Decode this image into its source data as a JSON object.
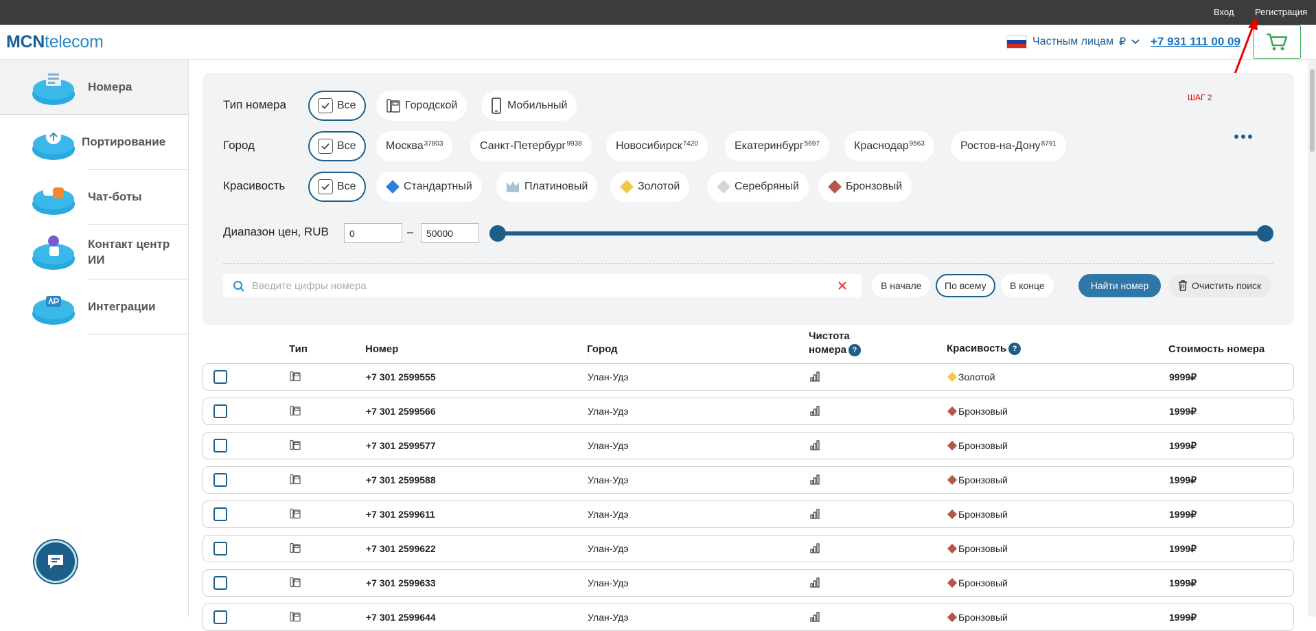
{
  "topbar": {
    "login": "Вход",
    "register": "Регистрация"
  },
  "header": {
    "logo_bold": "MCN",
    "logo_light": "telecom",
    "segment": "Частным лицам",
    "currency": "₽",
    "phone": "+7 931 111 00 09"
  },
  "sidebar": {
    "items": [
      {
        "label": "Номера",
        "active": true
      },
      {
        "label": "Портирование"
      },
      {
        "label": "Чат-боты"
      },
      {
        "label": "Контакт центр ИИ"
      },
      {
        "label": "Интеграции"
      }
    ]
  },
  "annotation": {
    "step": "ШАГ 2"
  },
  "filters": {
    "type_label": "Тип номера",
    "types": [
      "Все",
      "Городской",
      "Мобильный"
    ],
    "city_label": "Город",
    "city_all": "Все",
    "cities": [
      {
        "name": "Москва",
        "count": "37803"
      },
      {
        "name": "Санкт-Петербург",
        "count": "9938"
      },
      {
        "name": "Новосибирск",
        "count": "7420"
      },
      {
        "name": "Екатеринбург",
        "count": "5697"
      },
      {
        "name": "Краснодар",
        "count": "9563"
      },
      {
        "name": "Ростов-на-Дону",
        "count": "8791"
      }
    ],
    "beauty_label": "Красивость",
    "beauty": [
      "Все",
      "Стандартный",
      "Платиновый",
      "Золотой",
      "Серебряный",
      "Бронзовый"
    ],
    "price_label": "Диапазон цен, RUB",
    "price_min": "0",
    "price_dash": "–",
    "price_max": "50000",
    "search_placeholder": "Введите цифры номера",
    "search_modes": [
      "В начале",
      "По всему",
      "В конце"
    ],
    "find_label": "Найти номер",
    "clear_label": "Очистить поиск"
  },
  "colors": {
    "standard": "#2b7de0",
    "platinum": "#a9c4d1",
    "gold": "#f1c84b",
    "silver": "#d6d6d6",
    "bronze": "#b4574b"
  },
  "table": {
    "headers": {
      "type": "Тип",
      "number": "Номер",
      "city": "Город",
      "clean1": "Чистота",
      "clean2": "номера",
      "beauty": "Красивость",
      "price": "Стоимость номера",
      "q": "?"
    },
    "rows": [
      {
        "number": "+7 301 2599555",
        "city": "Улан-Удэ",
        "beauty": "Золотой",
        "price": "9999₽"
      },
      {
        "number": "+7 301 2599566",
        "city": "Улан-Удэ",
        "beauty": "Бронзовый",
        "price": "1999₽"
      },
      {
        "number": "+7 301 2599577",
        "city": "Улан-Удэ",
        "beauty": "Бронзовый",
        "price": "1999₽"
      },
      {
        "number": "+7 301 2599588",
        "city": "Улан-Удэ",
        "beauty": "Бронзовый",
        "price": "1999₽"
      },
      {
        "number": "+7 301 2599611",
        "city": "Улан-Удэ",
        "beauty": "Бронзовый",
        "price": "1999₽"
      },
      {
        "number": "+7 301 2599622",
        "city": "Улан-Удэ",
        "beauty": "Бронзовый",
        "price": "1999₽"
      },
      {
        "number": "+7 301 2599633",
        "city": "Улан-Удэ",
        "beauty": "Бронзовый",
        "price": "1999₽"
      },
      {
        "number": "+7 301 2599644",
        "city": "Улан-Удэ",
        "beauty": "Бронзовый",
        "price": "1999₽"
      }
    ]
  }
}
